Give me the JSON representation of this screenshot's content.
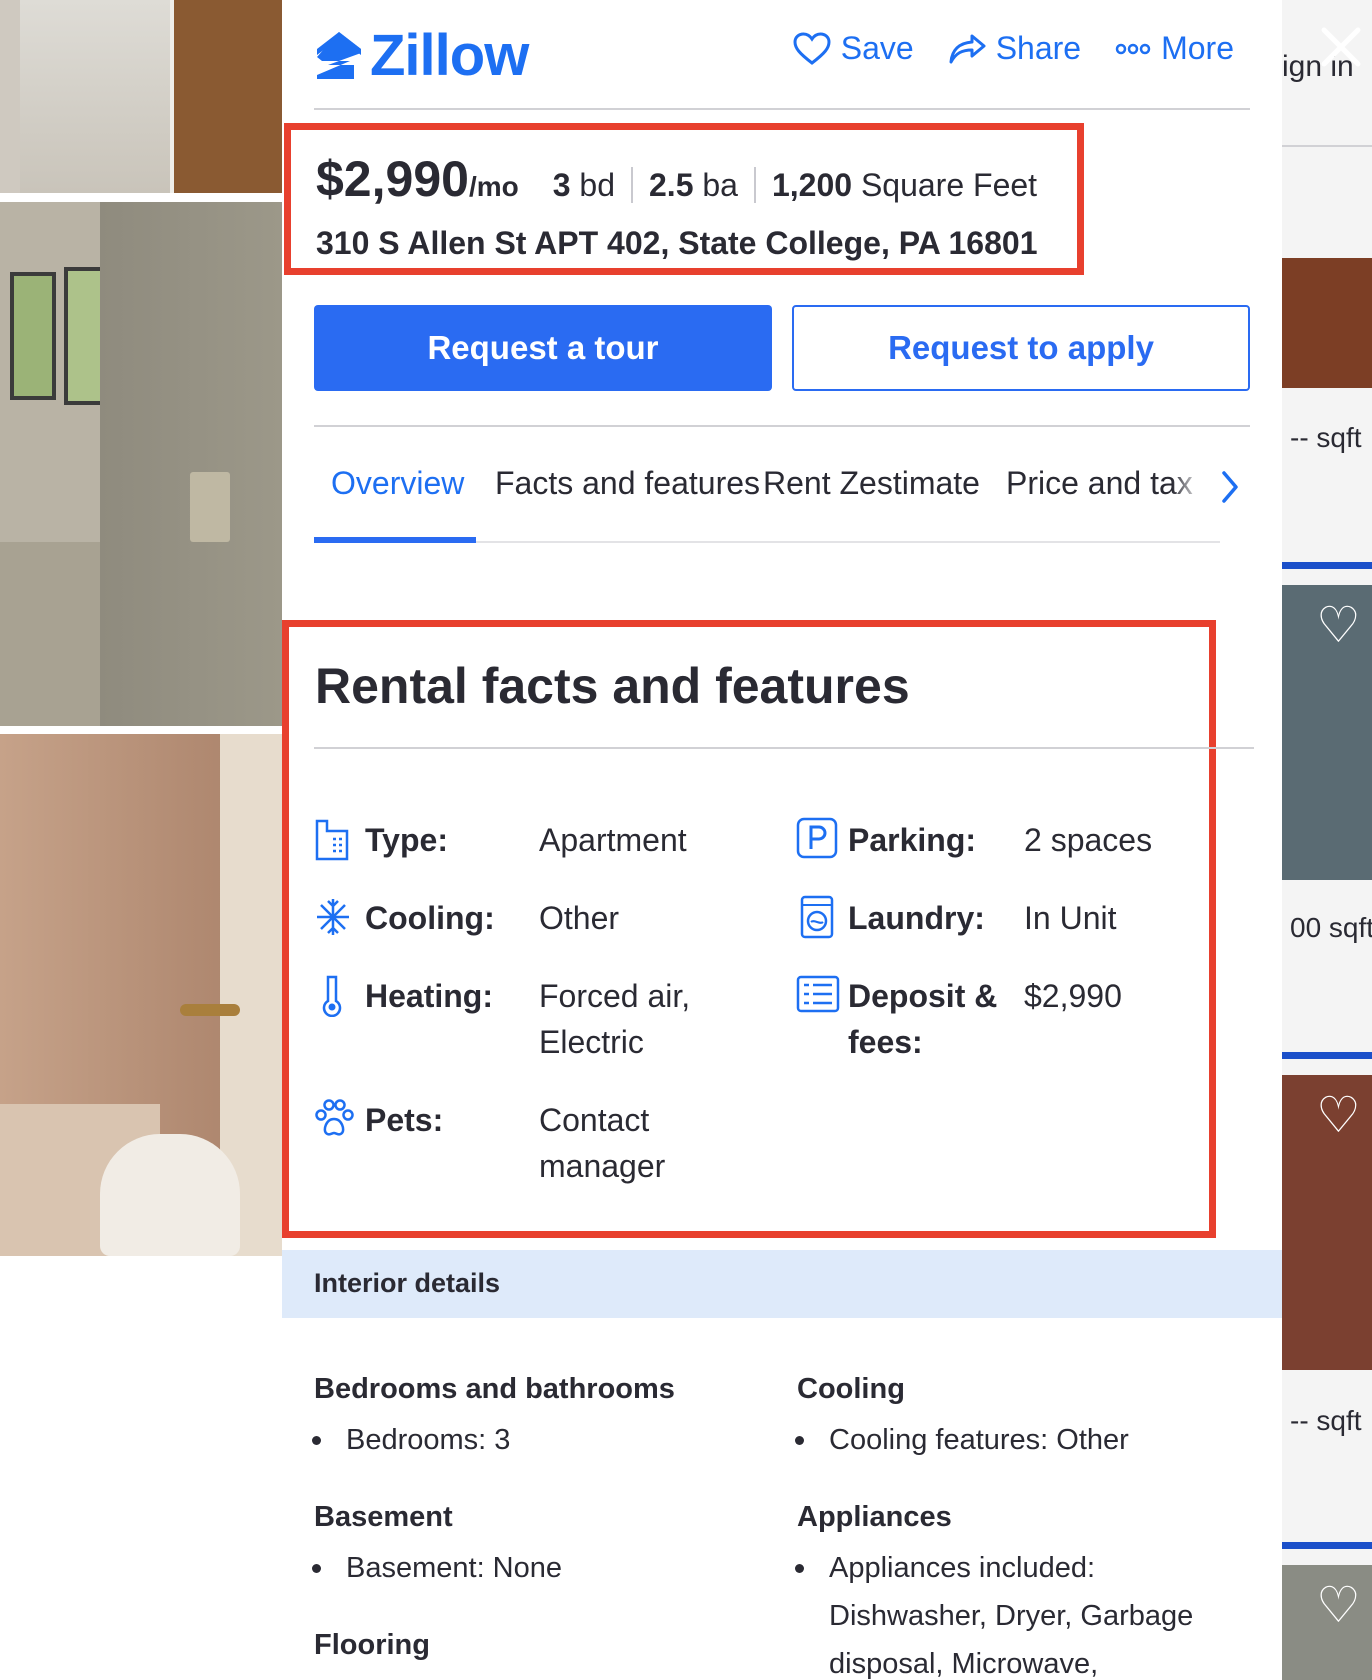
{
  "header": {
    "logo_text": "Zillow",
    "save_label": "Save",
    "share_label": "Share",
    "more_label": "More"
  },
  "listing": {
    "price": "$2,990",
    "price_unit": "/mo",
    "beds_value": "3",
    "beds_unit": "bd",
    "baths_value": "2.5",
    "baths_unit": "ba",
    "area_value": "1,200",
    "area_unit": "Square Feet",
    "address": "310 S Allen St APT 402, State College, PA 16801"
  },
  "buttons": {
    "tour": "Request a tour",
    "apply": "Request to apply"
  },
  "tabs": [
    {
      "label": "Overview",
      "active": true
    },
    {
      "label": "Facts and features",
      "active": false
    },
    {
      "label": "Rent Zestimate",
      "active": false
    },
    {
      "label": "Price and tax",
      "active": false
    }
  ],
  "facts": {
    "title": "Rental facts and features",
    "items": [
      {
        "icon": "building-icon",
        "label": "Type:",
        "value": "Apartment"
      },
      {
        "icon": "snowflake-icon",
        "label": "Cooling:",
        "value": "Other"
      },
      {
        "icon": "thermometer-icon",
        "label": "Heating:",
        "value": "Forced air, Electric"
      },
      {
        "icon": "paw-icon",
        "label": "Pets:",
        "value": "Contact manager"
      },
      {
        "icon": "parking-icon",
        "label": "Parking:",
        "value": "2 spaces"
      },
      {
        "icon": "washer-icon",
        "label": "Laundry:",
        "value": "In Unit"
      },
      {
        "icon": "fees-list-icon",
        "label": "Deposit & fees:",
        "value": "$2,990"
      }
    ]
  },
  "interior": {
    "band_label": "Interior details",
    "sections": [
      {
        "heading": "Bedrooms and bathrooms",
        "items": [
          "Bedrooms: 3"
        ]
      },
      {
        "heading": "Basement",
        "items": [
          "Basement: None"
        ]
      },
      {
        "heading": "Flooring",
        "items": []
      },
      {
        "heading": "Cooling",
        "items": [
          "Cooling features: Other"
        ]
      },
      {
        "heading": "Appliances",
        "items": [
          "Appliances included: Dishwasher, Dryer, Garbage disposal, Microwave,"
        ]
      }
    ]
  },
  "background": {
    "sign_in": "ign in",
    "sqft_1": "-- sqft",
    "sqft_2": "00 sqft",
    "sqft_3": "-- sqft"
  },
  "colors": {
    "brand_blue": "#1d6ff2",
    "button_blue": "#2a6bf2",
    "highlight_red": "#e8402e",
    "band_blue": "#deeafa"
  }
}
